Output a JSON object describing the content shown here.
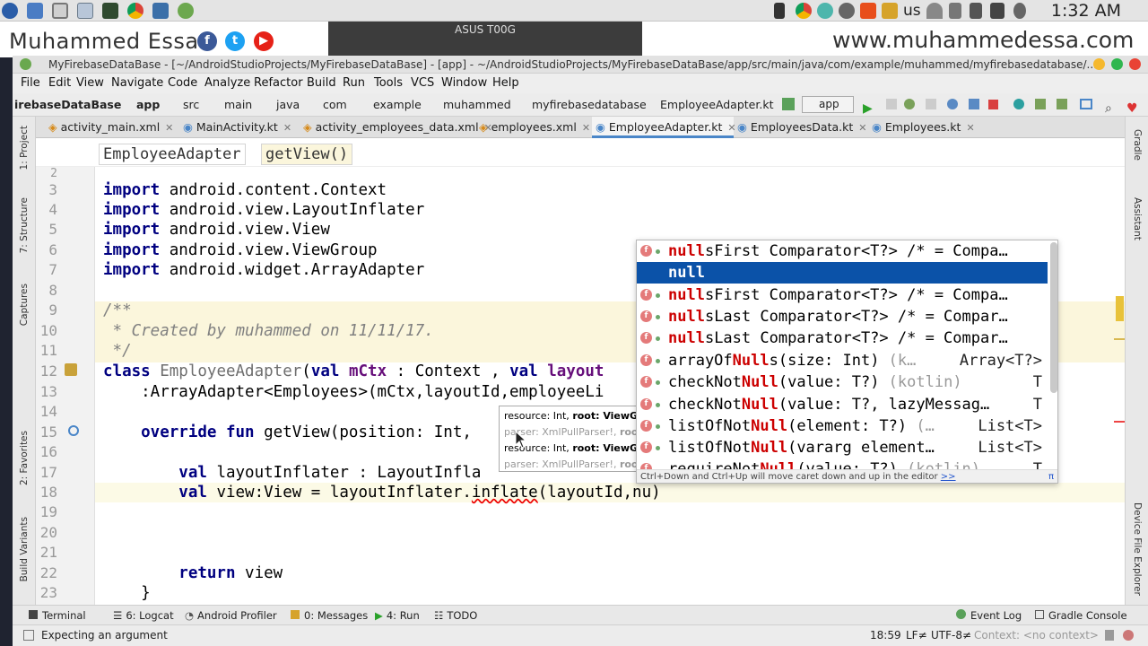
{
  "system_bar": {
    "keyboard_layout": "us",
    "clock": "1:32 AM"
  },
  "watermark": {
    "name": "Muhammed Essa",
    "site": "www.muhammedessa.com",
    "social": [
      "facebook-icon",
      "twitter-icon",
      "youtube-icon"
    ]
  },
  "phone_mirror": {
    "title": "ASUS T00G"
  },
  "window": {
    "title": "MyFirebaseDataBase - [~/AndroidStudioProjects/MyFirebaseDataBase] - [app] - ~/AndroidStudioProjects/MyFirebaseDataBase/app/src/main/java/com/example/muhammed/myfirebasedatabase/..."
  },
  "menu": [
    "File",
    "Edit",
    "View",
    "Navigate",
    "Code",
    "Analyze",
    "Refactor",
    "Build",
    "Run",
    "Tools",
    "VCS",
    "Window",
    "Help"
  ],
  "breadcrumbs": [
    "irebaseDataBase",
    "app",
    "src",
    "main",
    "java",
    "com",
    "example",
    "muhammed",
    "myfirebasedatabase",
    "EmployeeAdapter.kt"
  ],
  "run_config": "app",
  "tabs": [
    {
      "label": "activity_main.xml",
      "active": false
    },
    {
      "label": "MainActivity.kt",
      "active": false
    },
    {
      "label": "activity_employees_data.xml",
      "active": false
    },
    {
      "label": "employees.xml",
      "active": false
    },
    {
      "label": "EmployeeAdapter.kt",
      "active": true
    },
    {
      "label": "EmployeesData.kt",
      "active": false
    },
    {
      "label": "Employees.kt",
      "active": false
    }
  ],
  "left_tools": [
    "1: Project",
    "7: Structure",
    "Captures",
    "2: Favorites",
    "Build Variants"
  ],
  "right_tools": [
    "Gradle",
    "Assistant",
    "Device File Explorer"
  ],
  "editor_breadcrumb": [
    "EmployeeAdapter",
    "getView()"
  ],
  "code": {
    "lines": {
      "l3": {
        "num": "3",
        "kw": "import",
        "rest": " android.content.Context"
      },
      "l4": {
        "num": "4",
        "kw": "import",
        "rest": " android.view.LayoutInflater"
      },
      "l5": {
        "num": "5",
        "kw": "import",
        "rest": " android.view.View"
      },
      "l6": {
        "num": "6",
        "kw": "import",
        "rest": " android.view.ViewGroup"
      },
      "l7": {
        "num": "7",
        "kw": "import",
        "rest": " android.widget.ArrayAdapter"
      },
      "l8": {
        "num": "8"
      },
      "l9": {
        "num": "9",
        "text": "/**"
      },
      "l10": {
        "num": "10",
        "text": " * Created by muhammed on 11/11/17."
      },
      "l11": {
        "num": "11",
        "text": " */"
      },
      "l12": {
        "num": "12",
        "kw": "class",
        "cls": " EmployeeAdapter",
        "a": "(",
        "kw2": "val",
        "fld": " mCtx",
        "b": " : Context , ",
        "kw3": "val",
        "fld2": " layout"
      },
      "l13": {
        "num": "13",
        "text": "    :ArrayAdapter<Employees>(mCtx,layoutId,employeeLi"
      },
      "l14": {
        "num": "14"
      },
      "l15": {
        "num": "15",
        "kw": "    override fun",
        "rest": " getView(position: Int,"
      },
      "l16": {
        "num": "16"
      },
      "l17": {
        "num": "17",
        "kw": "        val",
        "rest": " layoutInflater : LayoutInfla"
      },
      "l18": {
        "num": "18",
        "kw": "        val",
        "rest": " view:View = layoutInflater.",
        "err": "inflate",
        "rest2": "(layoutId,nu)"
      },
      "l19": {
        "num": "19"
      },
      "l20": {
        "num": "20"
      },
      "l21": {
        "num": "21"
      },
      "l22": {
        "num": "22",
        "kw": "        return",
        "rest": " view"
      },
      "l23": {
        "num": "23",
        "text": "    }"
      }
    },
    "top_partial_line": "2"
  },
  "completion": {
    "items": [
      {
        "match": "null",
        "name": "sFirst Comparator<T?> /* = Compa…",
        "tail": ""
      },
      {
        "match": "null",
        "name": "",
        "tail": ""
      },
      {
        "match": "null",
        "name": "sFirst Comparator<T?> /* = Compa…",
        "tail": ""
      },
      {
        "match": "null",
        "name": "sLast Comparator<T?> /* = Compar…",
        "tail": ""
      },
      {
        "match": "null",
        "name": "sLast Comparator<T?> /* = Compar…",
        "tail": ""
      },
      {
        "pre": "arrayOf",
        "match": "Null",
        "name": "s(size: Int) ",
        "grey": "(k…",
        "tail": "Array<T?>"
      },
      {
        "pre": "checkNot",
        "match": "Null",
        "name": "(value: T?) ",
        "grey": "(kotlin)",
        "tail": "T"
      },
      {
        "pre": "checkNot",
        "match": "Null",
        "name": "(value: T?, lazyMessag…",
        "tail": "T"
      },
      {
        "pre": "listOfNot",
        "match": "Null",
        "name": "(element: T?) ",
        "grey": "(…",
        "tail": "List<T>"
      },
      {
        "pre": "listOfNot",
        "match": "Null",
        "name": "(vararg element…",
        "tail": "List<T>"
      },
      {
        "pre": "requireNot",
        "match": "Null",
        "name": "(value: T?) ",
        "grey": "(kotlin)",
        "tail": "T"
      }
    ],
    "hint": "Ctrl+Down and Ctrl+Up will move caret down and up in the editor",
    "hint_link": ">>",
    "pi": "π"
  },
  "param_hint": {
    "r1a": "resource: Int, ",
    "r1b": "root: ViewGr",
    "r2a": "parser: XmlPullParser!, ",
    "r2b": "roo",
    "r3a": "resource: Int, ",
    "r3b": "root: ViewGr",
    "r4a": "parser: XmlPullParser!, ",
    "r4b": "roo"
  },
  "bottom_tools": [
    "Terminal",
    "6: Logcat",
    "Android Profiler",
    "0: Messages",
    "4: Run",
    "TODO",
    "Event Log",
    "Gradle Console"
  ],
  "status": {
    "message": "Expecting an argument",
    "position": "18:59",
    "line_sep": "LF≠",
    "encoding": "UTF-8≠",
    "context": "Context: <no context>"
  }
}
